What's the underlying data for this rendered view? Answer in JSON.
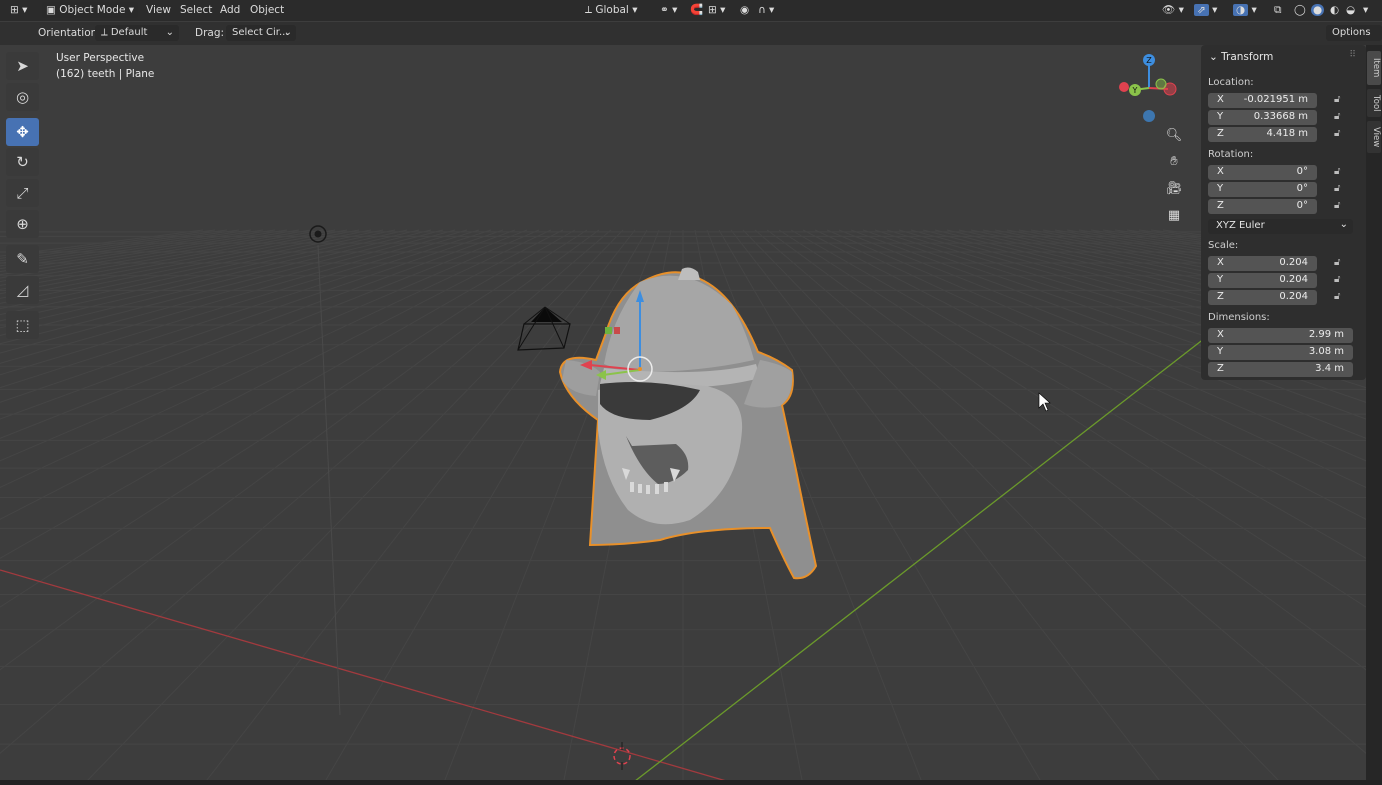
{
  "header": {
    "mode": "Object Mode",
    "menus": [
      "View",
      "Select",
      "Add",
      "Object"
    ],
    "transform_orientation": "Global"
  },
  "tool_header": {
    "orientation_label": "Orientation:",
    "orientation_value": "Default",
    "drag_label": "Drag:",
    "drag_value": "Select Cir...",
    "options_label": "Options"
  },
  "viewport": {
    "view_name": "User Perspective",
    "object_info": "(162) teeth | Plane"
  },
  "toolbar": {
    "tools": [
      {
        "name": "select-tool",
        "icon": "cursor-arrow-icon",
        "glyph": "➤"
      },
      {
        "name": "cursor-tool",
        "icon": "3d-cursor-icon",
        "glyph": "◎"
      },
      {
        "name": "move-tool",
        "icon": "move-arrows-icon",
        "glyph": "✥",
        "active": true
      },
      {
        "name": "rotate-tool",
        "icon": "rotate-icon",
        "glyph": "↻"
      },
      {
        "name": "scale-tool",
        "icon": "scale-icon",
        "glyph": "⤢"
      },
      {
        "name": "transform-tool",
        "icon": "transform-icon",
        "glyph": "⊕"
      },
      {
        "name": "annotate-tool",
        "icon": "pencil-icon",
        "glyph": "✎"
      },
      {
        "name": "measure-tool",
        "icon": "ruler-icon",
        "glyph": "📐"
      },
      {
        "name": "add-cube-tool",
        "icon": "add-cube-icon",
        "glyph": "⬚"
      }
    ]
  },
  "gizmo": {
    "axes": {
      "x": "X",
      "y": "Y",
      "z": "Z"
    },
    "colors": {
      "x": "#e0424f",
      "y": "#8bc34a",
      "z": "#3d8ee0"
    }
  },
  "transform_panel": {
    "title": "Transform",
    "location_label": "Location:",
    "location": [
      {
        "axis": "X",
        "value": "-0.021951 m"
      },
      {
        "axis": "Y",
        "value": "0.33668 m"
      },
      {
        "axis": "Z",
        "value": "4.418 m"
      }
    ],
    "rotation_label": "Rotation:",
    "rotation": [
      {
        "axis": "X",
        "value": "0°"
      },
      {
        "axis": "Y",
        "value": "0°"
      },
      {
        "axis": "Z",
        "value": "0°"
      }
    ],
    "rotation_mode": "XYZ Euler",
    "scale_label": "Scale:",
    "scale": [
      {
        "axis": "X",
        "value": "0.204"
      },
      {
        "axis": "Y",
        "value": "0.204"
      },
      {
        "axis": "Z",
        "value": "0.204"
      }
    ],
    "dimensions_label": "Dimensions:",
    "dimensions": [
      {
        "axis": "X",
        "value": "2.99 m"
      },
      {
        "axis": "Y",
        "value": "3.08 m"
      },
      {
        "axis": "Z",
        "value": "3.4 m"
      }
    ]
  },
  "side_tabs": [
    "Item",
    "Tool",
    "View"
  ],
  "colors": {
    "accent": "#4772b3",
    "selection_outline": "#e8902a",
    "x_axis_line": "#b03a3f",
    "y_axis_line": "#6a9a2a"
  }
}
